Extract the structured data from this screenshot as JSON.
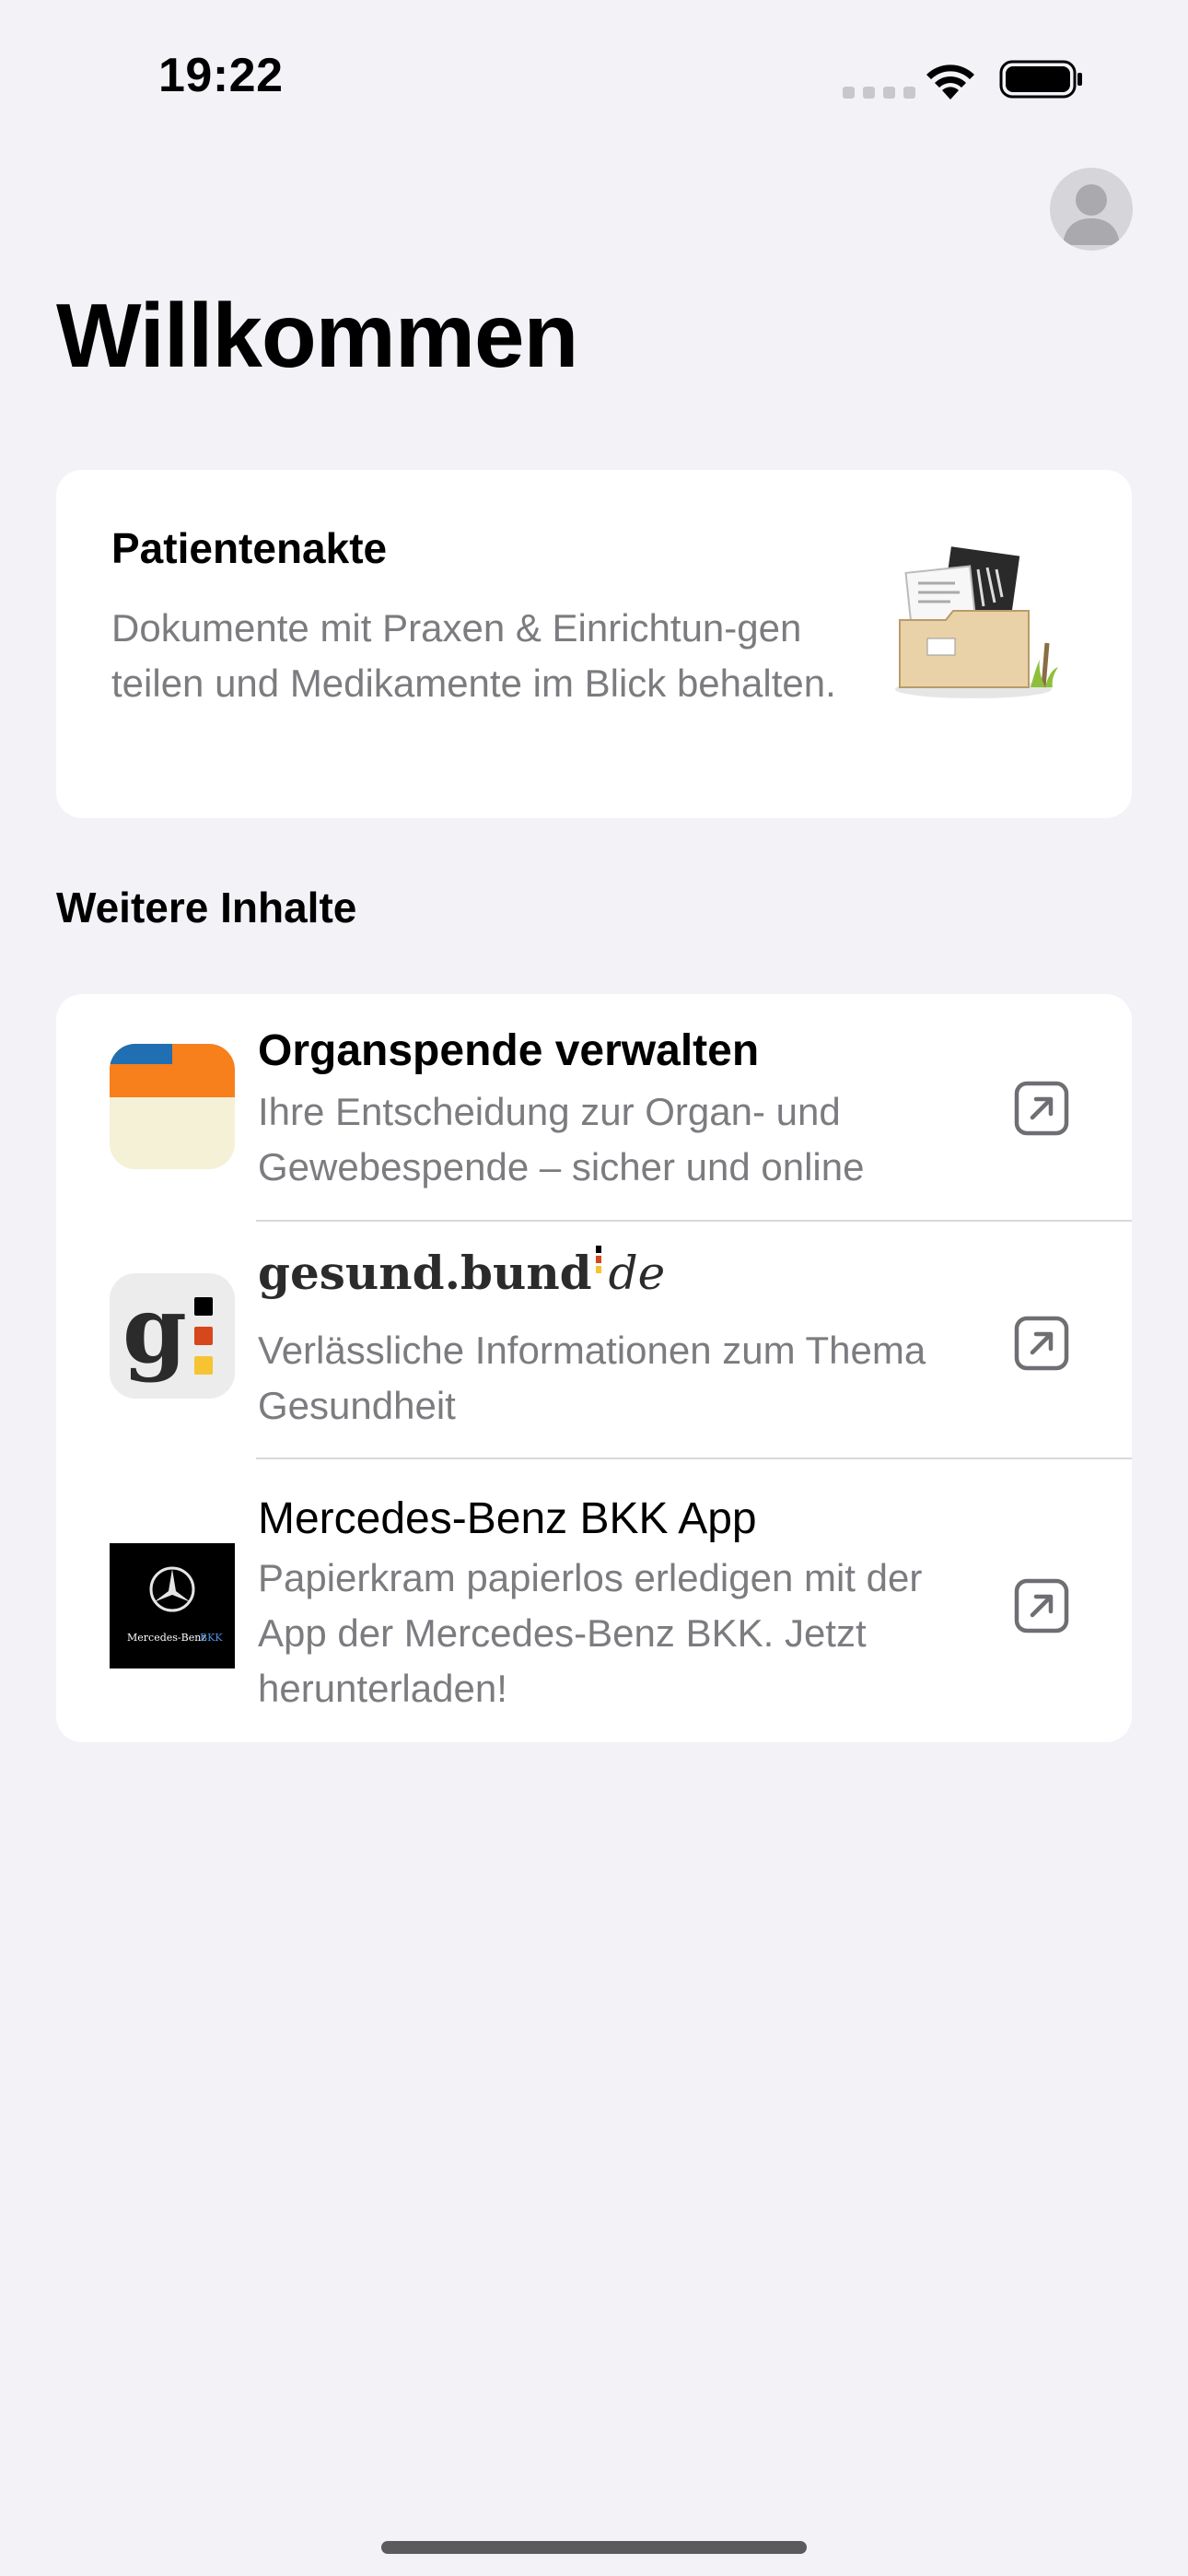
{
  "status_bar": {
    "time": "19:22",
    "signal_icon": "cellular-signal-icon",
    "wifi_icon": "wifi-icon",
    "battery_icon": "battery-icon"
  },
  "header": {
    "title": "Willkommen",
    "avatar_icon": "profile-avatar-icon"
  },
  "patient_card": {
    "title": "Patientenakte",
    "description": "Dokumente mit Praxen & Einrichtun-gen teilen und Medikamente im Blick behalten.",
    "illustration": "document-folder-illustration"
  },
  "more_section": {
    "title": "Weitere Inhalte",
    "items": [
      {
        "title": "Organspende verwalten",
        "description": "Ihre Entscheidung zur Organ- und Gewebespende – sicher und online",
        "icon": "organspende-app-icon",
        "action_icon": "external-link-icon"
      },
      {
        "title": "gesund.bund.de",
        "logo_part1": "gesund",
        "logo_part2": ".bund",
        "logo_part3": "de",
        "description": "Verlässliche Informationen zum Thema Gesundheit",
        "icon": "gesund-bund-app-icon",
        "action_icon": "external-link-icon"
      },
      {
        "title": "Mercedes-Benz BKK App",
        "description": "Papierkram papierlos erledigen mit der App der Mercedes-Benz BKK. Jetzt herunterladen!",
        "icon": "mercedes-benz-bkk-app-icon",
        "icon_text_1": "Mercedes-Benz",
        "icon_text_2": "BKK",
        "action_icon": "external-link-icon"
      }
    ]
  },
  "colors": {
    "background": "#f2f2f7",
    "card": "#ffffff",
    "secondary_text": "#7c7c80",
    "organspende_blue": "#1f6fb2",
    "organspende_orange": "#f77f1c",
    "organspende_cream": "#f5f1d6"
  }
}
